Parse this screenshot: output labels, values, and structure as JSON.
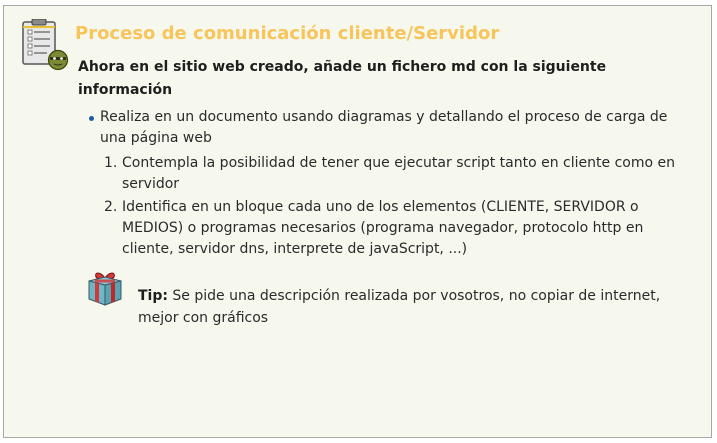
{
  "activity": {
    "title": "Proceso de comunicación cliente/Servidor",
    "subtitle": "Ahora en el sitio web creado, añade un fichero md con la siguiente información",
    "icon": "clipboard-task-icon"
  },
  "items": [
    {
      "text": "Realiza en un documento usando diagramas y detallando el proceso de carga de una página web",
      "steps": [
        {
          "number": "1.",
          "text": "Contempla la posibilidad de tener que ejecutar script tanto en cliente como en servidor"
        },
        {
          "number": "2.",
          "text": "Identifica en un bloque cada uno de los elementos (CLIENTE, SERVIDOR o MEDIOS) o programas necesarios (programa navegador, protocolo http en cliente, servidor dns, interprete de javaScript, ...)"
        }
      ]
    }
  ],
  "tip": {
    "label": "Tip:",
    "text": " Se pide una descripción realizada por vosotros, no copiar de internet, mejor con gráficos",
    "icon": "gift-box-icon"
  },
  "colors": {
    "title": "#f7c55b",
    "panel_background": "#f6f8ee",
    "panel_border": "#a8a8a8",
    "bullet": "#1e5aa8"
  }
}
